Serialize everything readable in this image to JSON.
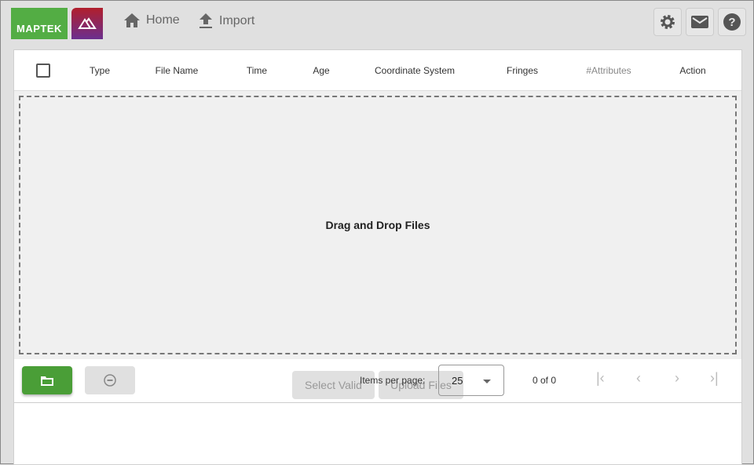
{
  "header": {
    "brand": "MAPTEK",
    "nav": [
      {
        "label": "Home",
        "icon": "home-icon"
      },
      {
        "label": "Import",
        "icon": "upload-icon"
      }
    ],
    "icons": [
      "gear-icon",
      "mail-icon",
      "help-icon"
    ]
  },
  "table": {
    "columns": [
      "Type",
      "File Name",
      "Time",
      "Age",
      "Coordinate System",
      "Fringes",
      "#Attributes",
      "Action"
    ]
  },
  "dropzone": {
    "label": "Drag and Drop Files"
  },
  "paginator": {
    "items_per_page_label": "Items per page:",
    "page_size": "25",
    "range": "0 of 0"
  },
  "footer": {
    "select_valid": "Select Valid",
    "upload_files": "Upload Files"
  },
  "colors": {
    "green": "#4a9e37",
    "brand_green": "#53ad44"
  }
}
